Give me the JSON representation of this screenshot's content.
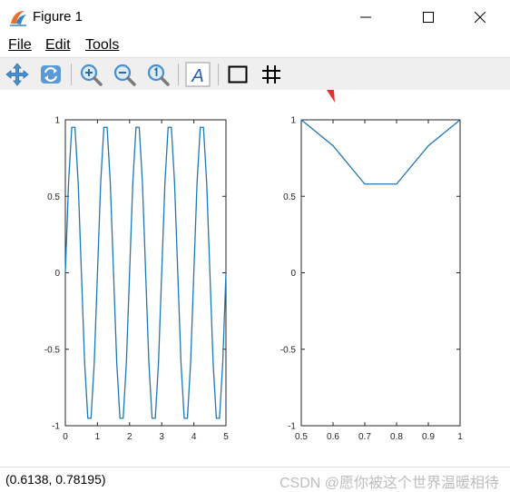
{
  "window": {
    "title": "Figure 1",
    "controls": [
      "minimize",
      "maximize",
      "close"
    ]
  },
  "menu": {
    "file": "File",
    "edit": "Edit",
    "tools": "Tools"
  },
  "toolbar": {
    "buttons": [
      "pan",
      "rotate",
      "zoom-in",
      "zoom-out",
      "zoom-reset",
      "text",
      "axes-box",
      "grid"
    ]
  },
  "status": {
    "coordinates": "(0.6138, 0.78195)",
    "watermark": "CSDN @愿你被这个世界温暖相待"
  },
  "colors": {
    "line": "#1f77b4",
    "annotation_arrow": "#e8322f"
  },
  "chart_data": [
    {
      "type": "line",
      "xlim": [
        0,
        5
      ],
      "ylim": [
        -1,
        1
      ],
      "xticks": [
        "0",
        "1",
        "2",
        "3",
        "4",
        "5"
      ],
      "yticks": [
        "1",
        "0.5",
        "0",
        "-0.5",
        "-1"
      ],
      "series": [
        {
          "x": [
            0,
            0.1,
            0.2,
            0.3,
            0.4,
            0.5,
            0.6,
            0.7,
            0.8,
            0.9,
            1.0,
            1.1,
            1.2,
            1.3,
            1.4,
            1.5,
            1.6,
            1.7,
            1.8,
            1.9,
            2.0,
            2.1,
            2.2,
            2.3,
            2.4,
            2.5,
            2.6,
            2.7,
            2.8,
            2.9,
            3.0,
            3.1,
            3.2,
            3.3,
            3.4,
            3.5,
            3.6,
            3.7,
            3.8,
            3.9,
            4.0,
            4.1,
            4.2,
            4.3,
            4.4,
            4.5,
            4.6,
            4.7,
            4.8,
            4.9,
            5.0
          ],
          "y": [
            0,
            0.588,
            0.951,
            0.951,
            0.588,
            0,
            -0.588,
            -0.951,
            -0.951,
            -0.588,
            0,
            0.588,
            0.951,
            0.951,
            0.588,
            0,
            -0.588,
            -0.951,
            -0.951,
            -0.588,
            0,
            0.588,
            0.951,
            0.951,
            0.588,
            0,
            -0.588,
            -0.951,
            -0.951,
            -0.588,
            0,
            0.588,
            0.951,
            0.951,
            0.588,
            0,
            -0.588,
            -0.951,
            -0.951,
            -0.588,
            0,
            0.588,
            0.951,
            0.951,
            0.588,
            0,
            -0.588,
            -0.951,
            -0.951,
            -0.588,
            0
          ]
        }
      ]
    },
    {
      "type": "line",
      "xlim": [
        0.5,
        1
      ],
      "ylim": [
        -1,
        1
      ],
      "xticks": [
        "0.5",
        "0.6",
        "0.7",
        "0.8",
        "0.9",
        "1"
      ],
      "yticks": [
        "1",
        "0.5",
        "0",
        "-0.5",
        "-1"
      ],
      "series": [
        {
          "x": [
            0.5,
            0.6,
            0.7,
            0.8,
            0.9,
            1.0
          ],
          "y": [
            1,
            0.83,
            0.58,
            0.58,
            0.83,
            1
          ]
        }
      ]
    }
  ]
}
